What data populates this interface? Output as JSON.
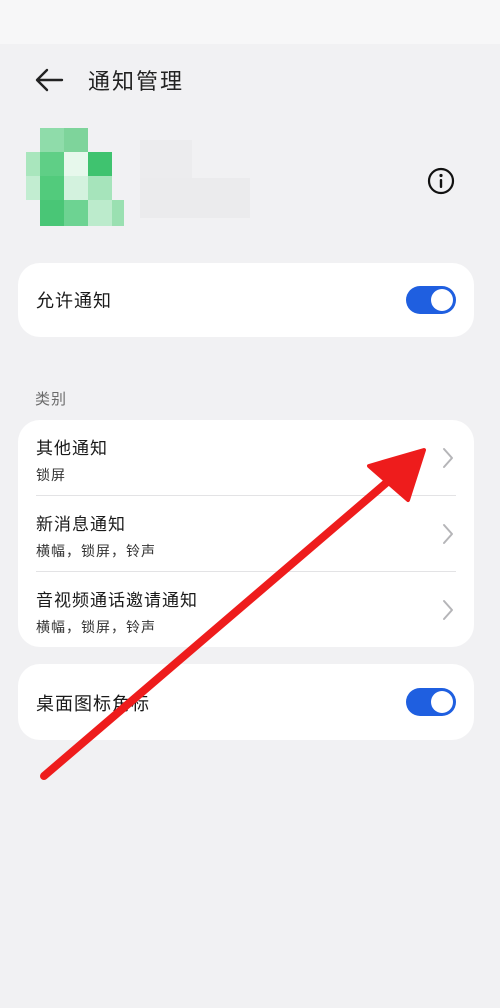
{
  "header": {
    "title": "通知管理",
    "back_icon": "back-arrow-icon"
  },
  "app": {
    "icon": "app-icon-pixelated",
    "info_icon": "info-icon"
  },
  "allow_notifications": {
    "label": "允许通知",
    "enabled": true
  },
  "category_section": {
    "label": "类别"
  },
  "categories": [
    {
      "title": "其他通知",
      "subtitle": "锁屏"
    },
    {
      "title": "新消息通知",
      "subtitle": "横幅，锁屏，铃声"
    },
    {
      "title": "音视频通话邀请通知",
      "subtitle": "横幅，锁屏，铃声"
    }
  ],
  "badge": {
    "label": "桌面图标角标",
    "enabled": true
  },
  "colors": {
    "accent": "#1f5fe0",
    "annotation_arrow": "#ee1c1c",
    "background": "#f1f1f3"
  }
}
